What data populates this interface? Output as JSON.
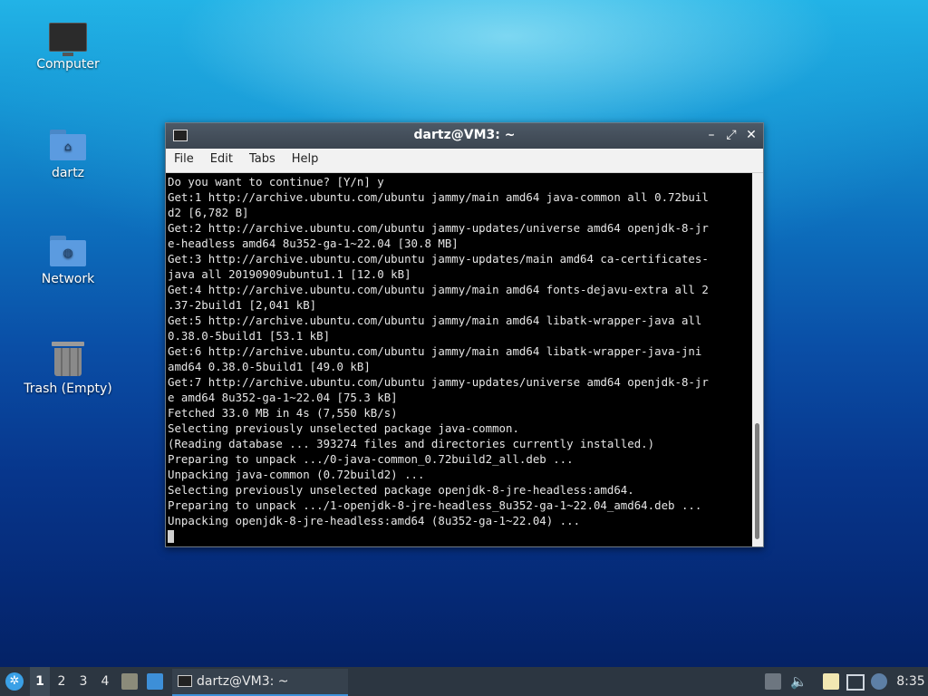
{
  "desktop": {
    "icons": [
      {
        "label": "Computer",
        "icon": "computer-icon"
      },
      {
        "label": "dartz",
        "icon": "home-folder-icon"
      },
      {
        "label": "Network",
        "icon": "network-folder-icon"
      },
      {
        "label": "Trash (Empty)",
        "icon": "trash-icon"
      }
    ]
  },
  "window": {
    "title": "dartz@VM3: ~",
    "controls": {
      "minimize": "–",
      "maximize": "⤢",
      "close": "✕"
    },
    "menu": [
      "File",
      "Edit",
      "Tabs",
      "Help"
    ],
    "terminal_lines": [
      "Do you want to continue? [Y/n] y",
      "Get:1 http://archive.ubuntu.com/ubuntu jammy/main amd64 java-common all 0.72buil",
      "d2 [6,782 B]",
      "Get:2 http://archive.ubuntu.com/ubuntu jammy-updates/universe amd64 openjdk-8-jr",
      "e-headless amd64 8u352-ga-1~22.04 [30.8 MB]",
      "Get:3 http://archive.ubuntu.com/ubuntu jammy-updates/main amd64 ca-certificates-",
      "java all 20190909ubuntu1.1 [12.0 kB]",
      "Get:4 http://archive.ubuntu.com/ubuntu jammy/main amd64 fonts-dejavu-extra all 2",
      ".37-2build1 [2,041 kB]",
      "Get:5 http://archive.ubuntu.com/ubuntu jammy/main amd64 libatk-wrapper-java all",
      "0.38.0-5build1 [53.1 kB]",
      "Get:6 http://archive.ubuntu.com/ubuntu jammy/main amd64 libatk-wrapper-java-jni",
      "amd64 0.38.0-5build1 [49.0 kB]",
      "Get:7 http://archive.ubuntu.com/ubuntu jammy-updates/universe amd64 openjdk-8-jr",
      "e amd64 8u352-ga-1~22.04 [75.3 kB]",
      "Fetched 33.0 MB in 4s (7,550 kB/s)",
      "Selecting previously unselected package java-common.",
      "(Reading database ... 393274 files and directories currently installed.)",
      "Preparing to unpack .../0-java-common_0.72build2_all.deb ...",
      "Unpacking java-common (0.72build2) ...",
      "Selecting previously unselected package openjdk-8-jre-headless:amd64.",
      "Preparing to unpack .../1-openjdk-8-jre-headless_8u352-ga-1~22.04_amd64.deb ...",
      "Unpacking openjdk-8-jre-headless:amd64 (8u352-ga-1~22.04) ..."
    ]
  },
  "taskbar": {
    "start_icon": "lubuntu-start-icon",
    "workspaces": [
      "1",
      "2",
      "3",
      "4"
    ],
    "active_workspace": "1",
    "task": {
      "label": "dartz@VM3: ~",
      "icon": "terminal-icon"
    },
    "tray_icons": [
      "update-notifier-icon",
      "volume-icon",
      "clipboard-icon",
      "network-wired-icon",
      "notification-icon"
    ],
    "clock": "8:35"
  },
  "colors": {
    "taskbar_bg": "#2c3641",
    "accent": "#3d8fd8",
    "titlebar": "#3b4550"
  }
}
